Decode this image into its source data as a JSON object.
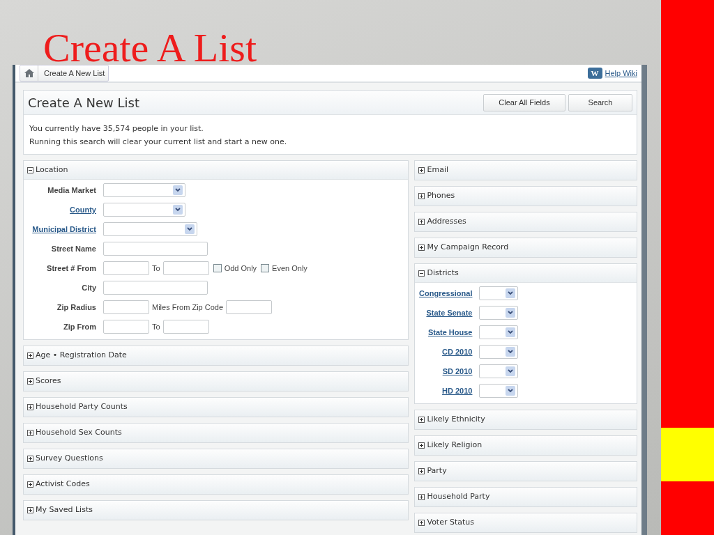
{
  "slide": {
    "title": "Create A List"
  },
  "breadcrumb": {
    "items": [
      "Create A New List"
    ]
  },
  "help_link": {
    "badge": "W",
    "label": "Help Wiki"
  },
  "header": {
    "title": "Create A New List",
    "buttons": [
      "Clear All Fields",
      "Search"
    ],
    "messages": [
      "You currently have 35,574 people in your list.",
      "Running this search will clear your current list and start a new one."
    ]
  },
  "left_panels": [
    {
      "title": "Location",
      "expanded": true,
      "rows": [
        {
          "label": "Media Market",
          "linked": false,
          "controls": [
            {
              "kind": "select"
            }
          ]
        },
        {
          "label": "County",
          "linked": true,
          "controls": [
            {
              "kind": "select"
            }
          ]
        },
        {
          "label": "Municipal District",
          "linked": true,
          "controls": [
            {
              "kind": "wide-select"
            }
          ]
        },
        {
          "label": "Street Name",
          "linked": false,
          "controls": [
            {
              "kind": "field"
            }
          ]
        },
        {
          "label": "Street # From",
          "linked": false,
          "controls": [
            {
              "kind": "short-field"
            },
            {
              "kind": "text",
              "text": "To"
            },
            {
              "kind": "short-field"
            },
            {
              "kind": "checkbox",
              "text": "Odd Only",
              "checked": false
            },
            {
              "kind": "checkbox",
              "text": "Even Only",
              "checked": false
            }
          ]
        },
        {
          "label": "City",
          "linked": false,
          "controls": [
            {
              "kind": "field"
            }
          ]
        },
        {
          "label": "Zip Radius",
          "linked": false,
          "controls": [
            {
              "kind": "short-field"
            },
            {
              "kind": "text",
              "text": "Miles From Zip Code"
            },
            {
              "kind": "short-field"
            }
          ]
        },
        {
          "label": "Zip From",
          "linked": false,
          "controls": [
            {
              "kind": "short-field"
            },
            {
              "kind": "text",
              "text": "To"
            },
            {
              "kind": "short-field"
            }
          ]
        }
      ]
    },
    {
      "title": "Age • Registration Date",
      "expanded": false
    },
    {
      "title": "Scores",
      "expanded": false
    },
    {
      "title": "Household Party Counts",
      "expanded": false
    },
    {
      "title": "Household Sex Counts",
      "expanded": false
    },
    {
      "title": "Survey Questions",
      "expanded": false
    },
    {
      "title": "Activist Codes",
      "expanded": false
    },
    {
      "title": "My Saved Lists",
      "expanded": false
    }
  ],
  "right_panels": [
    {
      "title": "Email",
      "expanded": false
    },
    {
      "title": "Phones",
      "expanded": false
    },
    {
      "title": "Addresses",
      "expanded": false
    },
    {
      "title": "My Campaign Record",
      "expanded": false
    },
    {
      "title": "Districts",
      "expanded": true,
      "rows": [
        {
          "label": "Congressional",
          "linked": true,
          "controls": [
            {
              "kind": "small-select"
            }
          ]
        },
        {
          "label": "State Senate",
          "linked": true,
          "controls": [
            {
              "kind": "small-select"
            }
          ]
        },
        {
          "label": "State House",
          "linked": true,
          "controls": [
            {
              "kind": "small-select"
            }
          ]
        },
        {
          "label": "CD 2010",
          "linked": true,
          "controls": [
            {
              "kind": "small-select"
            }
          ]
        },
        {
          "label": "SD 2010",
          "linked": true,
          "controls": [
            {
              "kind": "small-select"
            }
          ]
        },
        {
          "label": "HD 2010",
          "linked": true,
          "controls": [
            {
              "kind": "small-select"
            }
          ]
        }
      ]
    },
    {
      "title": "Likely Ethnicity",
      "expanded": false
    },
    {
      "title": "Likely Religion",
      "expanded": false
    },
    {
      "title": "Party",
      "expanded": false
    },
    {
      "title": "Household Party",
      "expanded": false
    },
    {
      "title": "Voter Status",
      "expanded": false
    }
  ]
}
